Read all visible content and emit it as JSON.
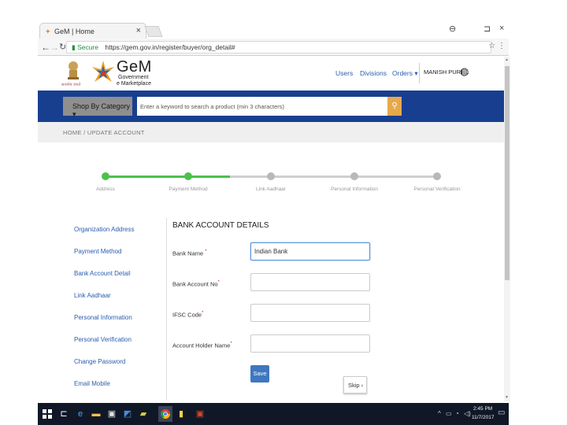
{
  "browser": {
    "tab_title": "GeM | Home",
    "tab_close": "×",
    "url_secure": "Secure",
    "url": "https://gem.gov.in/register/buyer/org_detail#",
    "window_controls": [
      "⊖",
      "⊐",
      "×"
    ]
  },
  "header": {
    "emblem_caption": "सत्यमेव जयते",
    "logo_title": "GeM",
    "logo_sub1": "Government",
    "logo_sub2": "e Marketplace",
    "nav": [
      "Users",
      "Divisions",
      "Orders ▾"
    ],
    "username": "MANISH PURI ..."
  },
  "searchbar": {
    "category_label": "Shop By Category ▾",
    "placeholder": "Enter a keyword to search a product (min 3 characters)"
  },
  "breadcrumb": "HOME / UPDATE ACCOUNT",
  "stepper": {
    "steps": [
      "Address",
      "Payment Method",
      "Link Aadhaar",
      "Personal Information",
      "Personal Verification"
    ],
    "completed": 2
  },
  "sidebar": {
    "items": [
      "Organization Address",
      "Payment Method",
      "Bank Account Detail",
      "Link Aadhaar",
      "Personal Information",
      "Personal Verification",
      "Change Password",
      "Email Mobile"
    ]
  },
  "form": {
    "title": "BANK ACCOUNT DETAILS",
    "fields": [
      {
        "label": "Bank Name",
        "value": "Indian Bank"
      },
      {
        "label": "Bank Account No",
        "value": ""
      },
      {
        "label": "IFSC Code",
        "value": ""
      },
      {
        "label": "Account Holder Name",
        "value": ""
      }
    ],
    "required_mark": "*",
    "save_label": "Save",
    "skip_label": "Skip ›"
  },
  "taskbar": {
    "time": "2:45 PM",
    "date": "11/7/2017"
  },
  "colors": {
    "header_blue": "#183f8f",
    "step_active": "#4cc04c",
    "step_inactive": "#b8b8b8",
    "link_blue": "#2a5db0",
    "search_btn": "#e8a84c"
  }
}
